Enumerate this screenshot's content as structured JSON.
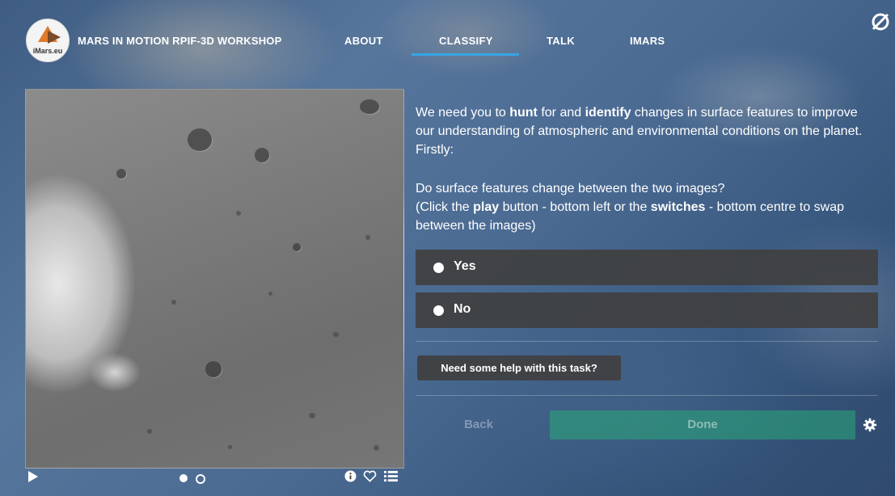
{
  "header": {
    "logo_text": "iMars.eu",
    "project_title": "MARS IN MOTION RPIF-3D WORKSHOP",
    "nav": [
      {
        "label": "ABOUT"
      },
      {
        "label": "CLASSIFY",
        "active": true
      },
      {
        "label": "TALK"
      },
      {
        "label": "IMARS"
      }
    ],
    "corner_icon": "no-symbol-icon"
  },
  "subject_viewer": {
    "controls": {
      "play_icon": "play-icon",
      "frame_dots": [
        {
          "state": "selected"
        },
        {
          "state": "unselected"
        }
      ],
      "tools": [
        "info-icon",
        "heart-icon",
        "list-icon"
      ]
    }
  },
  "task": {
    "intro_parts": [
      "We need you to ",
      "hunt",
      " for and ",
      "identify",
      " changes in surface features to improve our understanding of atmospheric and environmental conditions on the planet. Firstly:"
    ],
    "question_line1": "Do surface features change between the two images?",
    "question_line2_parts": [
      "(Click the ",
      "play",
      " button - bottom left or the ",
      "switches",
      " - bottom centre to swap between the images)"
    ],
    "answers": [
      {
        "label": "Yes"
      },
      {
        "label": "No"
      }
    ],
    "help_label": "Need some help with this task?",
    "back_label": "Back",
    "done_label": "Done",
    "settings_icon": "gear-icon"
  },
  "colors": {
    "accent": "#36a6e4",
    "answer_bg": "#404040",
    "done_bg": "#28aa78"
  }
}
